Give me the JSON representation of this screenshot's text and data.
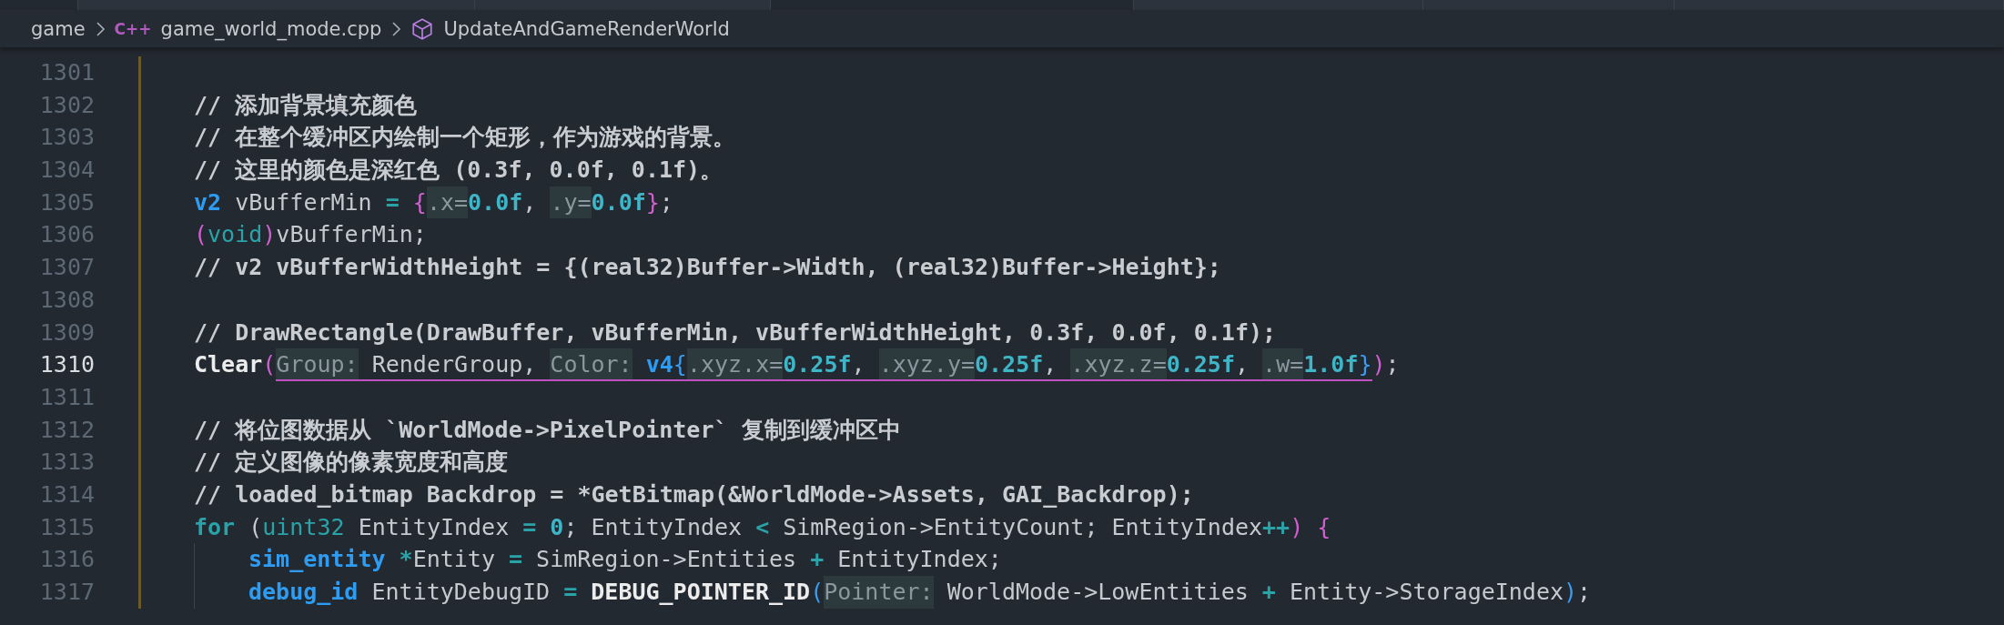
{
  "breadcrumb": [
    {
      "label": "game",
      "kind": "folder"
    },
    {
      "label": "game_world_mode.cpp",
      "kind": "file",
      "icon": "C++"
    },
    {
      "label": "UpdateAndGameRenderWorld",
      "kind": "symbol"
    }
  ],
  "lines": [
    {
      "number": "1301",
      "current": false
    },
    {
      "number": "1302",
      "current": false,
      "tokens": [
        {
          "text": "// 添加背景填充颜色",
          "kind": "comment"
        }
      ]
    },
    {
      "number": "1303",
      "current": false,
      "tokens": [
        {
          "text": "// 在整个缓冲区内绘制一个矩形，作为游戏的背景。",
          "kind": "comment"
        }
      ]
    },
    {
      "number": "1304",
      "current": false,
      "tokens": [
        {
          "text": "// 这里的颜色是深红色 (0.3f, 0.0f, 0.1f)。",
          "kind": "comment"
        }
      ]
    },
    {
      "number": "1305",
      "current": false,
      "tokens": [
        {
          "text": "v2",
          "kind": "type"
        },
        {
          "text": " vBufferMin ",
          "kind": "plain"
        },
        {
          "text": "= ",
          "kind": "operator"
        },
        {
          "text": "{",
          "kind": "brace"
        },
        {
          "text": ".x=",
          "kind": "hint"
        },
        {
          "text": "0.0f",
          "kind": "number"
        },
        {
          "text": ", ",
          "kind": "plain"
        },
        {
          "text": ".y=",
          "kind": "hint"
        },
        {
          "text": "0.0f",
          "kind": "number"
        },
        {
          "text": "}",
          "kind": "brace"
        },
        {
          "text": ";",
          "kind": "plain"
        }
      ]
    },
    {
      "number": "1306",
      "current": false,
      "tokens": [
        {
          "text": "(",
          "kind": "brace"
        },
        {
          "text": "void",
          "kind": "builtin"
        },
        {
          "text": ")",
          "kind": "brace"
        },
        {
          "text": "vBufferMin;",
          "kind": "plain"
        }
      ]
    },
    {
      "number": "1307",
      "current": false,
      "tokens": [
        {
          "text": "// v2 vBufferWidthHeight = {(real32)Buffer->Width, (real32)Buffer->Height};",
          "kind": "comment"
        }
      ]
    },
    {
      "number": "1308",
      "current": false
    },
    {
      "number": "1309",
      "current": false,
      "tokens": [
        {
          "text": "// DrawRectangle(DrawBuffer, vBufferMin, vBufferWidthHeight, 0.3f, 0.0f, 0.1f);",
          "kind": "comment"
        }
      ]
    },
    {
      "number": "1310",
      "current": true,
      "tokens": [
        {
          "text": "Clear",
          "kind": "function"
        },
        {
          "text": "(",
          "kind": "brace"
        },
        {
          "text": "Group:",
          "kind": "hint",
          "underlined": true
        },
        {
          "text": " RenderGroup, ",
          "kind": "plain",
          "underlined": true
        },
        {
          "text": "Color:",
          "kind": "hint",
          "underlined": true
        },
        {
          "text": " v4",
          "kind": "type",
          "underlined": true
        },
        {
          "text": "{",
          "kind": "blue_brace",
          "underlined": true
        },
        {
          "text": ".xyz.x=",
          "kind": "hint",
          "underlined": true
        },
        {
          "text": "0.25f",
          "kind": "number",
          "underlined": true
        },
        {
          "text": ", ",
          "kind": "plain",
          "underlined": true
        },
        {
          "text": ".xyz.y=",
          "kind": "hint",
          "underlined": true
        },
        {
          "text": "0.25f",
          "kind": "number",
          "underlined": true
        },
        {
          "text": ", ",
          "kind": "plain",
          "underlined": true
        },
        {
          "text": ".xyz.z=",
          "kind": "hint",
          "underlined": true
        },
        {
          "text": "0.25f",
          "kind": "number",
          "underlined": true
        },
        {
          "text": ", ",
          "kind": "plain",
          "underlined": true
        },
        {
          "text": ".w=",
          "kind": "hint",
          "underlined": true
        },
        {
          "text": "1.0f",
          "kind": "number",
          "underlined": true
        },
        {
          "text": "}",
          "kind": "blue_brace",
          "underlined": true
        },
        {
          "text": ")",
          "kind": "brace"
        },
        {
          "text": ";",
          "kind": "plain"
        }
      ]
    },
    {
      "number": "1311",
      "current": false
    },
    {
      "number": "1312",
      "current": false,
      "tokens": [
        {
          "text": "// 将位图数据从 `WorldMode->PixelPointer` 复制到缓冲区中",
          "kind": "comment"
        }
      ]
    },
    {
      "number": "1313",
      "current": false,
      "tokens": [
        {
          "text": "// 定义图像的像素宽度和高度",
          "kind": "comment"
        }
      ]
    },
    {
      "number": "1314",
      "current": false,
      "tokens": [
        {
          "text": "// loaded_bitmap Backdrop = *GetBitmap(&WorldMode->Assets, GAI_Backdrop);",
          "kind": "comment"
        }
      ]
    },
    {
      "number": "1315",
      "current": false,
      "tokens": [
        {
          "text": "for",
          "kind": "keyword"
        },
        {
          "text": " (",
          "kind": "plain"
        },
        {
          "text": "uint32",
          "kind": "builtin"
        },
        {
          "text": " EntityIndex ",
          "kind": "plain"
        },
        {
          "text": "= ",
          "kind": "operator"
        },
        {
          "text": "0",
          "kind": "number"
        },
        {
          "text": "; EntityIndex ",
          "kind": "plain"
        },
        {
          "text": "<",
          "kind": "operator"
        },
        {
          "text": " SimRegion->EntityCount; EntityIndex",
          "kind": "plain"
        },
        {
          "text": "++",
          "kind": "operator"
        },
        {
          "text": ")",
          "kind": "brace"
        },
        {
          "text": " {",
          "kind": "brace"
        }
      ],
      "children": [
        {
          "number": "1316",
          "current": false,
          "tokens": [
            {
              "text": "sim_entity",
              "kind": "type"
            },
            {
              "text": " *",
              "kind": "operator"
            },
            {
              "text": "Entity ",
              "kind": "plain"
            },
            {
              "text": "=",
              "kind": "operator"
            },
            {
              "text": " SimRegion->Entities ",
              "kind": "plain"
            },
            {
              "text": "+",
              "kind": "operator"
            },
            {
              "text": " EntityIndex;",
              "kind": "plain"
            }
          ]
        },
        {
          "number": "1317",
          "current": false,
          "tokens": [
            {
              "text": "debug_id",
              "kind": "type"
            },
            {
              "text": " EntityDebugID ",
              "kind": "plain"
            },
            {
              "text": "= ",
              "kind": "operator"
            },
            {
              "text": "DEBUG_POINTER_ID",
              "kind": "function"
            },
            {
              "text": "(",
              "kind": "blue_brace"
            },
            {
              "text": "Pointer:",
              "kind": "hint"
            },
            {
              "text": " WorldMode->LowEntities ",
              "kind": "plain"
            },
            {
              "text": "+",
              "kind": "operator"
            },
            {
              "text": " Entity->StorageIndex",
              "kind": "plain"
            },
            {
              "text": ")",
              "kind": "blue_brace"
            },
            {
              "text": ";",
              "kind": "plain"
            }
          ]
        }
      ]
    }
  ]
}
